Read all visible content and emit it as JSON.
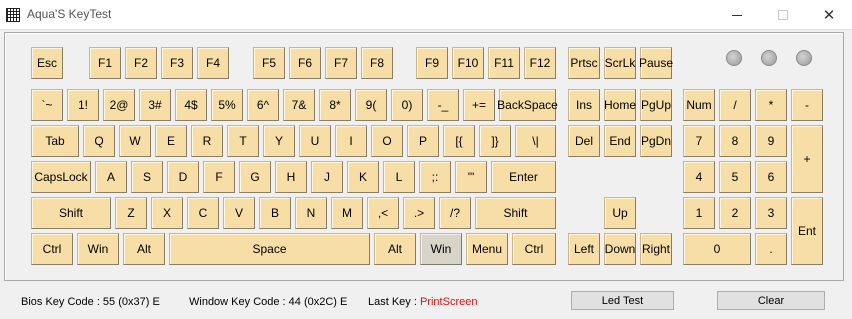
{
  "window": {
    "title": "Aqua'S KeyTest",
    "close_glyph": "✕"
  },
  "keys": {
    "esc": "Esc",
    "f1": "F1",
    "f2": "F2",
    "f3": "F3",
    "f4": "F4",
    "f5": "F5",
    "f6": "F6",
    "f7": "F7",
    "f8": "F8",
    "f9": "F9",
    "f10": "F10",
    "f11": "F11",
    "f12": "F12",
    "prtsc": "Prtsc",
    "scrlk": "ScrLk",
    "pause": "Pause",
    "backquote": "`~",
    "n1": "1!",
    "n2": "2@",
    "n3": "3#",
    "n4": "4$",
    "n5": "5%",
    "n6": "6^",
    "n7": "7&",
    "n8": "8*",
    "n9": "9(",
    "n0": "0)",
    "minus": "-_",
    "equal": "+=",
    "backspace": "BackSpace",
    "tab": "Tab",
    "q": "Q",
    "w": "W",
    "e": "E",
    "r": "R",
    "t": "T",
    "y": "Y",
    "u": "U",
    "i": "I",
    "o": "O",
    "p": "P",
    "lbracket": "[{",
    "rbracket": "]}",
    "backslash": "\\|",
    "capslock": "CapsLock",
    "a": "A",
    "s": "S",
    "d": "D",
    "f": "F",
    "g": "G",
    "h": "H",
    "j": "J",
    "k": "K",
    "l": "L",
    "semicolon": ";:",
    "quote": "'\"",
    "enter": "Enter",
    "lshift": "Shift",
    "z": "Z",
    "x": "X",
    "c": "C",
    "v": "V",
    "b": "B",
    "n": "N",
    "m": "M",
    "comma": ",<",
    "period": ".>",
    "slash": "/?",
    "rshift": "Shift",
    "lctrl": "Ctrl",
    "lwin": "Win",
    "lalt": "Alt",
    "space": "Space",
    "ralt": "Alt",
    "rwin": "Win",
    "menu": "Menu",
    "rctrl": "Ctrl",
    "ins": "Ins",
    "home": "Home",
    "pgup": "PgUp",
    "del": "Del",
    "end": "End",
    "pgdn": "PgDn",
    "up": "Up",
    "left": "Left",
    "down": "Down",
    "right": "Right",
    "num": "Num",
    "kp_div": "/",
    "kp_mul": "*",
    "kp_sub": "-",
    "kp7": "7",
    "kp8": "8",
    "kp9": "9",
    "kp_add": "+",
    "kp4": "4",
    "kp5": "5",
    "kp6": "6",
    "kp1": "1",
    "kp2": "2",
    "kp3": "3",
    "kp_enter": "Ent",
    "kp0": "0",
    "kp_dot": "."
  },
  "pressed_keys": [
    "rwin"
  ],
  "colors": {
    "key_face": "#f7dea6",
    "key_pressed": "#d8d4c8",
    "last_key": "#e01010"
  },
  "status": {
    "bios_label": "Bios Key Code : 55 (0x37) E",
    "window_label": "Window Key Code : 44 (0x2C) E",
    "last_key_label": "Last Key :",
    "last_key_value": "PrintScreen",
    "led_test_button": "Led Test",
    "clear_button": "Clear"
  }
}
